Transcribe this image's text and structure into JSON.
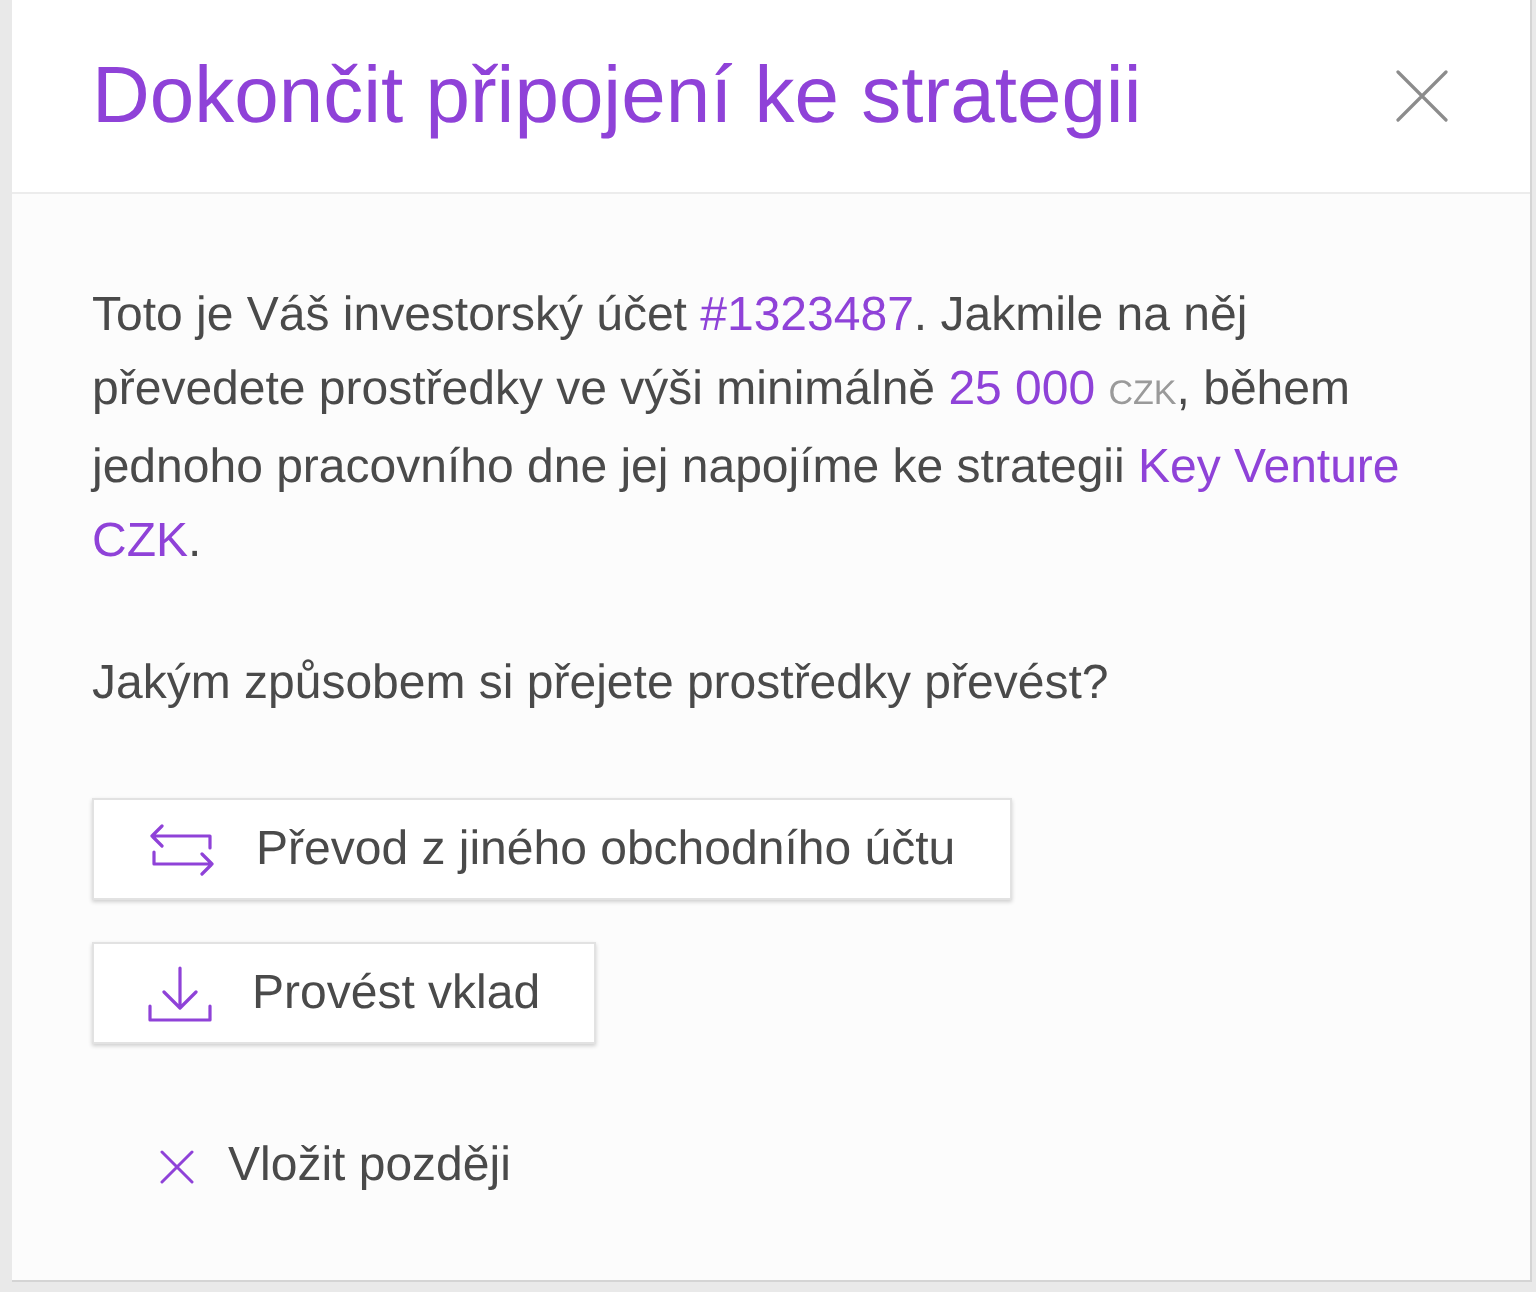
{
  "dialog": {
    "title": "Dokončit připojení ke strategii",
    "intro": [
      {
        "kind": "text",
        "text": "Toto je Váš investorský účet "
      },
      {
        "kind": "highlight",
        "text": "#1323487"
      },
      {
        "kind": "text",
        "text": ". Jakmile na něj převedete prostředky ve výši minimálně "
      },
      {
        "kind": "highlight",
        "text": "25 000"
      },
      {
        "kind": "unit",
        "text": "CZK"
      },
      {
        "kind": "text",
        "text": ", během jednoho pracovního dne jej napojíme ke strategii "
      },
      {
        "kind": "highlight",
        "text": "Key Venture CZK"
      },
      {
        "kind": "text",
        "text": "."
      }
    ],
    "question": "Jakým způsobem si přejete prostředky převést?",
    "options": [
      {
        "kind": "transfer",
        "label": "Převod z jiného obchodního účtu"
      },
      {
        "kind": "deposit",
        "label": "Provést vklad"
      }
    ],
    "later": {
      "label": "Vložit později"
    }
  }
}
